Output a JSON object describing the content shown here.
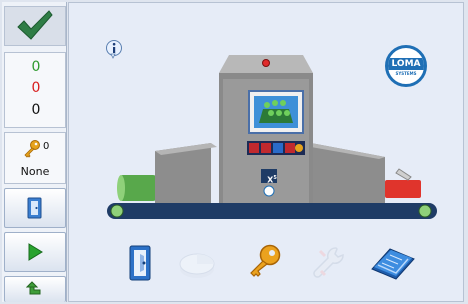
{
  "colors": {
    "good": "#2e9a2e",
    "rejected": "#d81e1e",
    "total": "#111111",
    "accent": "#1f6fb5"
  },
  "status": {
    "icon": "checkmark-icon",
    "good_count": "0",
    "reject_count": "0",
    "total_count": "0"
  },
  "security": {
    "icon": "key-icon",
    "level": "0",
    "user": "None"
  },
  "sidebar": {
    "buttons": [
      {
        "name": "exit-button",
        "icon": "door-exit-icon"
      },
      {
        "name": "run-button",
        "icon": "play-icon"
      },
      {
        "name": "back-button",
        "icon": "arrow-back-icon"
      }
    ]
  },
  "brand": {
    "logo_text": "LOMA",
    "logo_subtext": "SYSTEMS"
  },
  "machine": {
    "model_badge": "X",
    "model_sup": "5",
    "panel_labels": [
      "+",
      "+",
      "+"
    ]
  },
  "toolbar": {
    "items": [
      {
        "name": "exit-tool",
        "icon": "door-exit-icon",
        "enabled": true
      },
      {
        "name": "reports-tool",
        "icon": "pie-chart-icon",
        "enabled": false
      },
      {
        "name": "security-tool",
        "icon": "key-icon",
        "enabled": true
      },
      {
        "name": "setup-tool",
        "icon": "wrench-icon",
        "enabled": false
      },
      {
        "name": "product-tool",
        "icon": "book-icon",
        "enabled": true
      }
    ]
  }
}
